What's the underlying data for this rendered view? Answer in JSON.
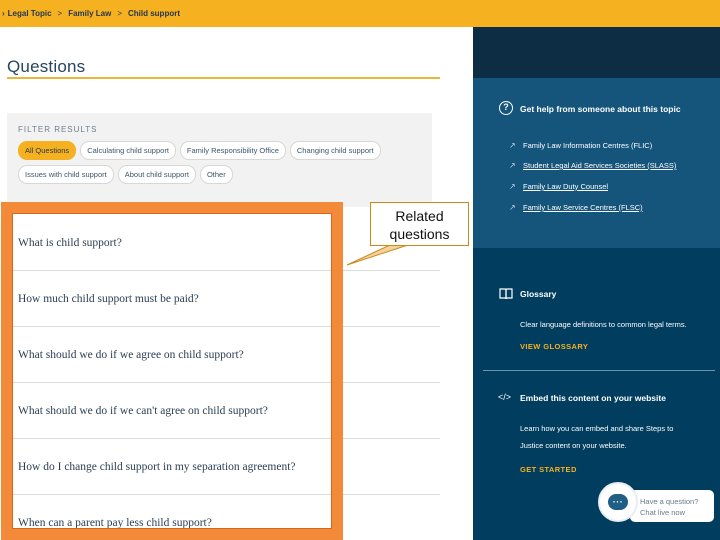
{
  "breadcrumb": {
    "items": [
      "Legal Topic",
      "Family Law",
      "Child support"
    ],
    "separator": ">"
  },
  "questions": {
    "title": "Questions",
    "filter_title": "FILTER RESULTS",
    "filters": [
      {
        "label": "All Questions",
        "active": true
      },
      {
        "label": "Calculating child support",
        "active": false
      },
      {
        "label": "Family Responsibility Office",
        "active": false
      },
      {
        "label": "Changing child support",
        "active": false
      },
      {
        "label": "Issues with child support",
        "active": false
      },
      {
        "label": "About child support",
        "active": false
      },
      {
        "label": "Other",
        "active": false
      }
    ],
    "items": [
      "What is child support?",
      "How much child support must be paid?",
      "What should we do if we agree on child support?",
      "What should we do if we can't agree on child support?",
      "How do I change child support in my separation agreement?",
      "When can a parent pay less child support?"
    ]
  },
  "callout": {
    "line1": "Related",
    "line2": "questions"
  },
  "help_section": {
    "icon": "question-circle-icon",
    "title": "Get help from someone about this topic",
    "links": [
      {
        "label": "Family Law Information Centres (FLIC)"
      },
      {
        "label": "Student Legal Aid Services Societies (SLASS)"
      },
      {
        "label": "Family Law Duty Counsel"
      },
      {
        "label": "Family Law Service Centres (FLSC)"
      }
    ]
  },
  "glossary": {
    "icon": "book-icon",
    "title": "Glossary",
    "description": "Clear language definitions to common legal terms.",
    "cta": "VIEW GLOSSARY"
  },
  "embed": {
    "icon": "code-icon",
    "title": "Embed this content on your website",
    "description_line1": "Learn how you can embed and share Steps to",
    "description_line2": "Justice content on your website.",
    "cta": "GET STARTED"
  },
  "chat": {
    "icon": "chat-bubble-icon",
    "line1": "Have a question?",
    "line2": "Chat live now"
  },
  "colors": {
    "accent": "#f5b120",
    "panel": "#003d5e",
    "highlight": "#f28a3a"
  }
}
